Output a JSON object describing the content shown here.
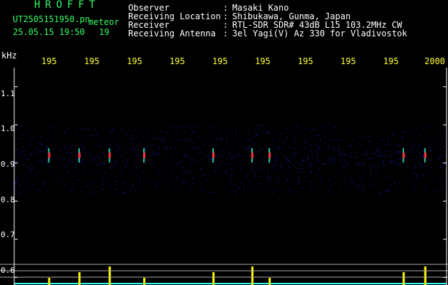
{
  "header": {
    "title": "HROFFT",
    "filename": "UT2505151950.pn",
    "meteor_label": "meteor",
    "datetime": "25.05.15 19:50",
    "count": "19",
    "observer_label": "Observer",
    "observer_value": "Masaki Kano",
    "location_label": "Receiving Location",
    "location_value": "Shibukawa, Gunma, Japan",
    "receiver_label": "Receiver",
    "receiver_value": "RTL-SDR SDR# 43dB L15 103.2MHz CW",
    "antenna_label": "Receiving Antenna",
    "antenna_value": "3el Yagi(V) Az 330 for Vladivostok",
    "separator": ":"
  },
  "axis": {
    "unit": "kHz",
    "y_ticks": [
      "1.1",
      "1.0",
      "0.9",
      "0.8",
      "0.7",
      "0.6"
    ],
    "x_ticks": [
      "195",
      "195",
      "195",
      "195",
      "195",
      "195",
      "195",
      "195",
      "195",
      "2000"
    ]
  },
  "colors": {
    "text_green": "#33ff66",
    "text_white": "#ffffff",
    "text_yellow": "#ffff33",
    "signal_hot": "#ff3344",
    "signal_mid": "#33ffcc",
    "noise": "#1a2bff",
    "activity": "#ffff00",
    "baseline": "#33ffff"
  },
  "chart_data": {
    "type": "heatmap",
    "xlabel": "",
    "ylabel": "kHz",
    "ylim": [
      0.58,
      1.15
    ],
    "signal_band_khz": [
      0.82,
      1.0
    ],
    "carrier_khz": 0.92,
    "meteor_events_minute_fraction": [
      0.08,
      0.15,
      0.22,
      0.3,
      0.46,
      0.55,
      0.59,
      0.9,
      0.95
    ]
  }
}
